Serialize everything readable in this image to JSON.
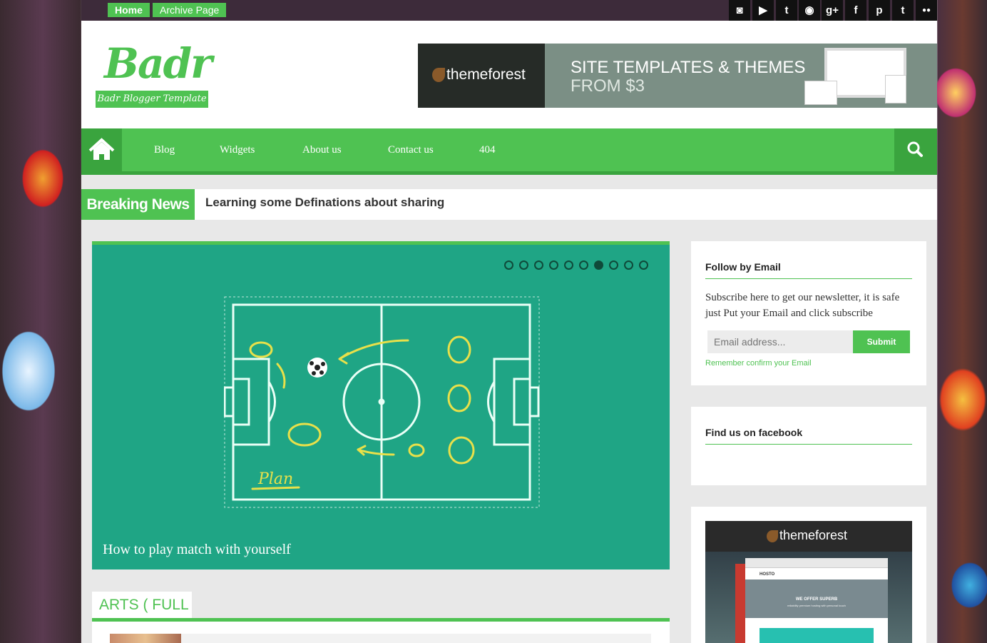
{
  "topbar": {
    "links": [
      "Home",
      "Archive Page"
    ],
    "social_icons": [
      "instagram-icon",
      "youtube-icon",
      "twitter-icon",
      "github-icon",
      "google-plus-icon",
      "facebook-icon",
      "pinterest-icon",
      "tumblr-icon",
      "flickr-icon"
    ],
    "social_glyphs": [
      "◙",
      "▶",
      "t",
      "◉",
      "g+",
      "f",
      "p",
      "t",
      "●●"
    ]
  },
  "header": {
    "logo": "Badr",
    "tagline": "Badr Blogger Template",
    "banner": {
      "brand": "themeforest",
      "line1": "SITE TEMPLATES & THEMES",
      "line2": "FROM $3"
    }
  },
  "nav": {
    "items": [
      "Blog",
      "Widgets",
      "About us",
      "Contact us",
      "404"
    ]
  },
  "breaking": {
    "label": "Breaking News",
    "headline": "Learning some Definations about sharing"
  },
  "slider": {
    "title": "How to play match with yourself",
    "dot_count": 10,
    "active_index": 6,
    "image_text": "Plan"
  },
  "arts": {
    "title": "ARTS ( FULL )"
  },
  "sidebar": {
    "follow": {
      "title": "Follow by Email",
      "description": "Subscribe here to get our newsletter, it is safe just Put your Email and click subscribe",
      "placeholder": "Email address...",
      "submit": "Submit",
      "note": "Remember confirm your Email"
    },
    "facebook": {
      "title": "Find us on facebook"
    },
    "ad": {
      "brand": "themeforest",
      "screen_brand": "HOSTO",
      "screen_heading": "WE OFFER SUPERB",
      "screen_sub": "reliability premium hosting with personal touch"
    }
  },
  "colors": {
    "accent": "#4fc252",
    "accent_dark": "#3aa43e",
    "topbar": "#3d2b3a",
    "slider_bg": "#1fa585"
  }
}
